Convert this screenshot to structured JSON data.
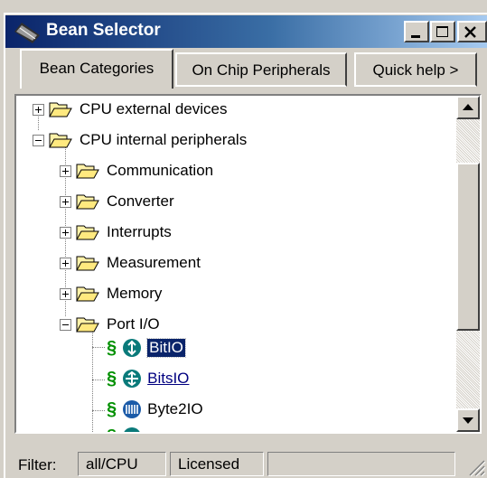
{
  "window": {
    "title": "Bean Selector",
    "colors": {
      "titlebar_start": "#0a246a",
      "titlebar_end": "#a6caf0",
      "selection": "#0a246a",
      "section_icon": "#009000"
    }
  },
  "tabs": [
    {
      "label": "Bean Categories",
      "active": true
    },
    {
      "label": "On Chip Peripherals",
      "active": false
    },
    {
      "label": "Quick help >",
      "active": false
    }
  ],
  "tree": {
    "cpu_external": {
      "label": "CPU external devices",
      "expanded": false,
      "icon": "folder-icon"
    },
    "cpu_internal": {
      "label": "CPU internal peripherals",
      "expanded": true,
      "icon": "folder-icon"
    },
    "communication": "Communication",
    "converter": "Converter",
    "interrupts": "Interrupts",
    "measurement": "Measurement",
    "memory": "Memory",
    "port_io": {
      "label": "Port I/O",
      "expanded": true
    },
    "beans": [
      {
        "label": "BitIO",
        "icon": "bitio-icon",
        "state": "selected"
      },
      {
        "label": "BitsIO",
        "icon": "bitsio-icon",
        "state": "hover-link"
      },
      {
        "label": "Byte2IO",
        "icon": "byte2io-icon",
        "state": "normal"
      }
    ]
  },
  "status": {
    "filter_label": "Filter:",
    "filter_value": "all/CPU",
    "license": "Licensed"
  }
}
